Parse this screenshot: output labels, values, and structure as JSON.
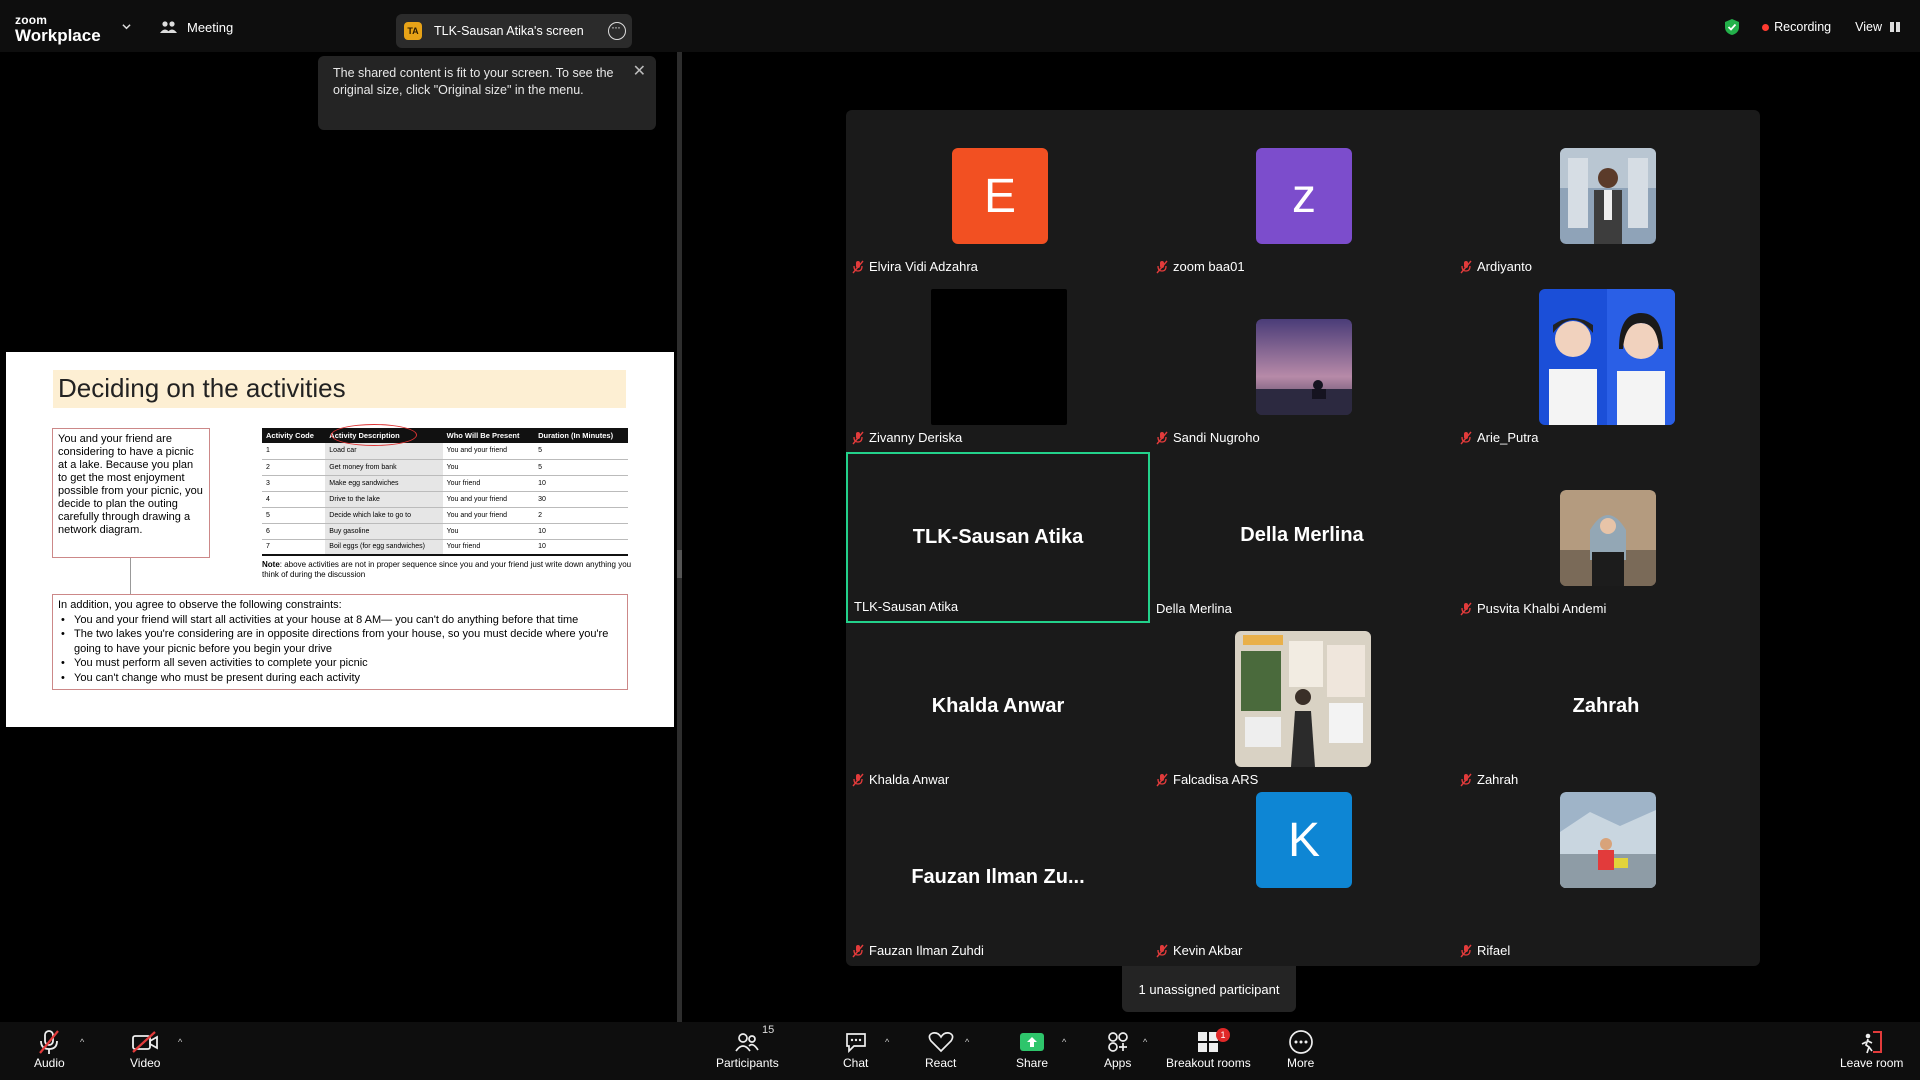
{
  "topbar": {
    "brand_small": "zoom",
    "brand_large": "Workplace",
    "meeting_label": "Meeting",
    "share_initials": "TA",
    "share_label": "TLK-Sausan Atika's screen",
    "recording_label": "Recording",
    "view_label": "View"
  },
  "tooltip": {
    "text": "The shared content is fit to your screen. To see the original size, click \"Original size\" in the menu."
  },
  "slide": {
    "title": "Deciding on the activities",
    "intro": "You and your friend are considering to have a picnic at a lake. Because you plan to get the most enjoyment possible from your picnic, you decide to plan the outing carefully through drawing a network diagram.",
    "table_headers": [
      "Activity Code",
      "Activity Description",
      "Who Will Be Present",
      "Duration (In Minutes)"
    ],
    "table_rows": [
      [
        "1",
        "Load car",
        "You and your friend",
        "5"
      ],
      [
        "2",
        "Get money from bank",
        "You",
        "5"
      ],
      [
        "3",
        "Make egg sandwiches",
        "Your friend",
        "10"
      ],
      [
        "4",
        "Drive to the lake",
        "You and your friend",
        "30"
      ],
      [
        "5",
        "Decide which lake to go to",
        "You and your friend",
        "2"
      ],
      [
        "6",
        "Buy gasoline",
        "You",
        "10"
      ],
      [
        "7",
        "Boil eggs (for egg sandwiches)",
        "Your friend",
        "10"
      ]
    ],
    "note_label": "Note",
    "note_text": ": above activities are not in proper sequence since you and your friend just write down anything you think of during the discussion",
    "constraints_intro": "In addition, you agree to observe the following constraints:",
    "constraints": [
      "You and your friend will start all activities at your house at 8 AM— you can't do anything before that time",
      "The two lakes you're considering are in opposite directions from your house, so you must decide where you're going to have your picnic before you begin your drive",
      "You must perform all seven activities to complete your picnic",
      "You can't change who must be present during each activity"
    ]
  },
  "participants": [
    {
      "name": "Elvira Vidi Adzahra",
      "avatar_letter": "E",
      "avatar_color": "#f25022",
      "muted": true
    },
    {
      "name": "zoom baa01",
      "avatar_letter": "z",
      "avatar_color": "#7c4dcc",
      "muted": true
    },
    {
      "name": "Ardiyanto",
      "muted": true
    },
    {
      "name": "Zivanny Deriska",
      "muted": true
    },
    {
      "name": "Sandi Nugroho",
      "muted": true
    },
    {
      "name": "Arie_Putra",
      "muted": true
    },
    {
      "name": "TLK-Sausan Atika",
      "big_name": "TLK-Sausan Atika",
      "muted": false,
      "active": true
    },
    {
      "name": "Della Merlina",
      "big_name": "Della Merlina",
      "muted": false
    },
    {
      "name": "Pusvita Khalbi Andemi",
      "muted": true
    },
    {
      "name": "Khalda Anwar",
      "big_name": "Khalda Anwar",
      "muted": true
    },
    {
      "name": "Falcadisa ARS",
      "muted": true
    },
    {
      "name": "Zahrah",
      "big_name": "Zahrah",
      "muted": true
    },
    {
      "name": "Fauzan Ilman Zuhdi",
      "big_name": "Fauzan  Ilman  Zu...",
      "muted": true
    },
    {
      "name": "Kevin Akbar",
      "avatar_letter": "K",
      "avatar_color": "#0e86d4",
      "muted": true
    },
    {
      "name": "Rifael",
      "muted": true
    }
  ],
  "unassigned_label": "1 unassigned participant",
  "toolbar": {
    "audio": "Audio",
    "video": "Video",
    "participants": "Participants",
    "participants_count": "15",
    "chat": "Chat",
    "react": "React",
    "share": "Share",
    "apps": "Apps",
    "breakout": "Breakout rooms",
    "breakout_badge": "1",
    "more": "More",
    "leave": "Leave room"
  },
  "colors": {
    "accent_green": "#23d18b",
    "record_red": "#ff3b30",
    "share_green": "#2ec56b"
  }
}
